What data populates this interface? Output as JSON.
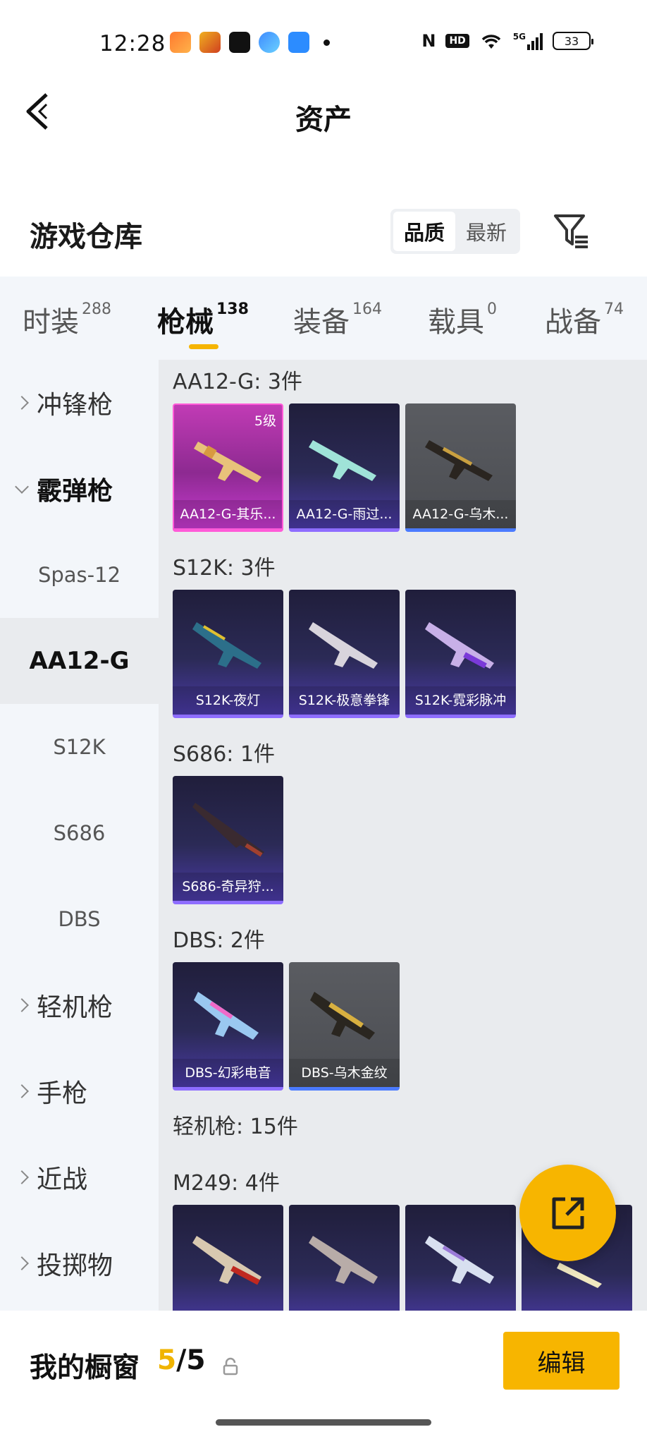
{
  "status_bar": {
    "time": "12:28",
    "network": "5G",
    "battery": "33"
  },
  "header": {
    "title": "资产"
  },
  "section": {
    "title": "游戏仓库",
    "sort_options": [
      "品质",
      "最新"
    ],
    "active_sort": "品质"
  },
  "tabs": [
    {
      "label": "时装",
      "count": "288"
    },
    {
      "label": "枪械",
      "count": "138"
    },
    {
      "label": "装备",
      "count": "164"
    },
    {
      "label": "载具",
      "count": "0"
    },
    {
      "label": "战备",
      "count": "74"
    }
  ],
  "sidebar": {
    "cat_smg": "冲锋枪",
    "cat_shotgun": "霰弹枪",
    "sub_spas": "Spas-12",
    "sub_aa12": "AA12-G",
    "sub_s12k": "S12K",
    "sub_s686": "S686",
    "sub_dbs": "DBS",
    "cat_lmg": "轻机枪",
    "cat_pistol": "手枪",
    "cat_melee": "近战",
    "cat_throw": "投掷物"
  },
  "groups": {
    "aa12": {
      "title": "AA12-G: 3件",
      "items": [
        "AA12-G-其乐...",
        "AA12-G-雨过...",
        "AA12-G-乌木..."
      ],
      "badge": "5级"
    },
    "s12k": {
      "title": "S12K: 3件",
      "items": [
        "S12K-夜灯",
        "S12K-极意拳锋",
        "S12K-霓彩脉冲"
      ]
    },
    "s686": {
      "title": "S686: 1件",
      "items": [
        "S686-奇异狩..."
      ]
    },
    "dbs": {
      "title": "DBS: 2件",
      "items": [
        "DBS-幻彩电音",
        "DBS-乌木金纹"
      ]
    },
    "lmg_title": "轻机枪: 15件",
    "m249_title": "M249: 4件"
  },
  "bottom_bar": {
    "title": "我的橱窗",
    "count_current": "5",
    "count_total": "/5",
    "edit_label": "编辑"
  },
  "icons": [
    "back-arrow-icon",
    "filter-icon",
    "share-icon",
    "lock-icon"
  ],
  "colors": {
    "accent": "#f7b500",
    "purple_rarity": "#8e6dff",
    "pink_rarity": "#ff5bd8",
    "blue_rarity": "#4b7bff"
  }
}
